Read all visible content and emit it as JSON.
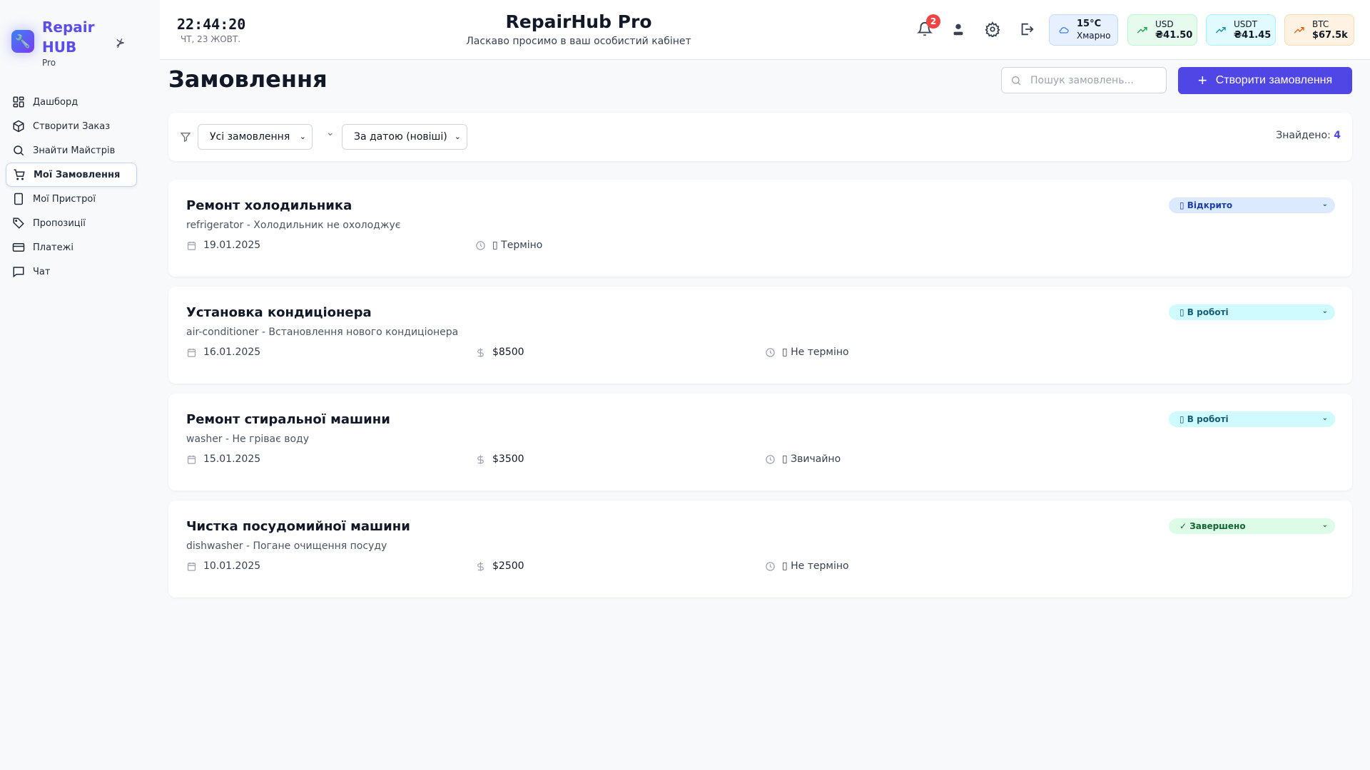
{
  "sidebar": {
    "brand_line1": "Repair",
    "brand_line2": "HUB",
    "brand_sub": "Pro",
    "items": [
      {
        "label": "Дашборд",
        "icon": "grid-icon"
      },
      {
        "label": "Створити Заказ",
        "icon": "box-icon"
      },
      {
        "label": "Знайти Майстрів",
        "icon": "search-icon"
      },
      {
        "label": "Мої Замовлення",
        "icon": "cart-icon",
        "active": true
      },
      {
        "label": "Мої Пристрої",
        "icon": "tablet-icon"
      },
      {
        "label": "Пропозиції",
        "icon": "tag-icon"
      },
      {
        "label": "Платежі",
        "icon": "credit-card-icon"
      },
      {
        "label": "Чат",
        "icon": "chat-icon"
      }
    ]
  },
  "header": {
    "time": "22:44:20",
    "date": "ЧТ, 23 ЖОВТ.",
    "title": "RepairHub Pro",
    "subtitle": "Ласкаво просимо в ваш особистий кабінет",
    "notifications": "2",
    "weather": {
      "temp": "15°C",
      "desc": "Хмарно"
    },
    "rates": [
      {
        "label": "USD",
        "value": "₴41.50",
        "color": "#16a34a"
      },
      {
        "label": "USDT",
        "value": "₴41.45",
        "color": "#0891b2"
      },
      {
        "label": "BTC",
        "value": "$67.5k",
        "color": "#ea580c"
      }
    ]
  },
  "main": {
    "title": "Замовлення",
    "search_placeholder": "Пошук замовлень...",
    "create_label": "Створити замовлення",
    "filter_status": "Усі замовлення",
    "sort": "За датою (новіші)",
    "found_label": "Знайдено:",
    "found_count": "4",
    "orders": [
      {
        "title": "Ремонт холодильника",
        "desc": "refrigerator - Холодильник не охолоджує",
        "date": "19.01.2025",
        "price": "",
        "urgency": "▯ Терміно",
        "status": "▯ Відкрито",
        "status_bg": "#dbeafe",
        "status_fg": "#1e40af"
      },
      {
        "title": "Установка кондиціонера",
        "desc": "air-conditioner - Встановлення нового кондиціонера",
        "date": "16.01.2025",
        "price": "$8500",
        "urgency": "▯ Не терміно",
        "status": "▯ В роботі",
        "status_bg": "#cffafe",
        "status_fg": "#155e75"
      },
      {
        "title": "Ремонт стиральної машини",
        "desc": "washer - Не гріває воду",
        "date": "15.01.2025",
        "price": "$3500",
        "urgency": "▯ Звичайно",
        "status": "▯ В роботі",
        "status_bg": "#cffafe",
        "status_fg": "#155e75"
      },
      {
        "title": "Чистка посудомийної машини",
        "desc": "dishwasher - Погане очищення посуду",
        "date": "10.01.2025",
        "price": "$2500",
        "urgency": "▯ Не терміно",
        "status": "✓ Завершено",
        "status_bg": "#dcfce7",
        "status_fg": "#166534"
      }
    ]
  }
}
